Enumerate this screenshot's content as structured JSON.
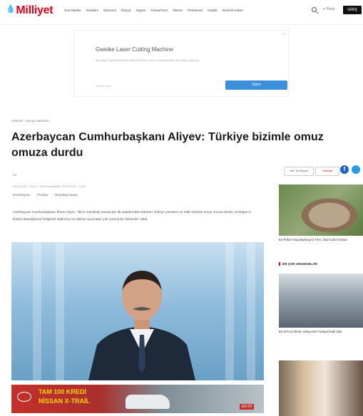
{
  "header": {
    "logo": "Milliyet",
    "nav": [
      "Son Dakika",
      "Gündem",
      "Ekonomi",
      "Dünya",
      "Yaşam",
      "GolvarFarm",
      "Skorer",
      "Pembenar",
      "Cadde",
      "Resimli Haber"
    ],
    "weather": "Paris",
    "login": "GİRİŞ"
  },
  "ad": {
    "badge": "i ✕",
    "title": "Gweike Laser Cutting Machine",
    "description": "Affordable High-Performance 60W/40W Fiber Laser Cutting Machines and metal engraving",
    "site": "Gweike Cloud",
    "button": "Open"
  },
  "article": {
    "breadcrumb": "Haberler › Dünya Haberleri",
    "title": "Azerbaycan Cumhurbaşkanı Aliyev: Türkiye bizimle omuz omuza durdu",
    "author": "AA",
    "dates": "10.10.2021 - 16:41 - Son Güncelleme: 10.10.2021 - 16:52",
    "tags": [
      "#Azerbaycan",
      "#Türkiye",
      "#Karabağ Savaşı"
    ],
    "summary": "Azerbaycan Cumhurbaşkanı İlham Aliyev, \"İkinci Karabağ Savaşı'ları ilk saatlerinden itibaren Türkiye yönetimi ve halkı bizimle omuz omuza durdu. Erdoğan'ın kişisel desteğinimiz bölgesel kalkınma ve istikrar açısından çok önemli bir faktördür\" dedi."
  },
  "banner": {
    "line1": "TAM 100 KREDİ",
    "line2": "NİSSAN X-TRAİL",
    "tag": "EN İYİ"
  },
  "sidebar": {
    "btn1": "Yazı Tipi Boyutu",
    "btn2": "Yorumlar",
    "fb": "f",
    "caption1": "Ex-Police Dog Barking At Tree, Dad Cuts It Down",
    "section_title": "EN ÇOK OKUNANLAR",
    "caption2": "Ek MTV'yi kimler ödeyecek? Detaylı belli oldu"
  }
}
